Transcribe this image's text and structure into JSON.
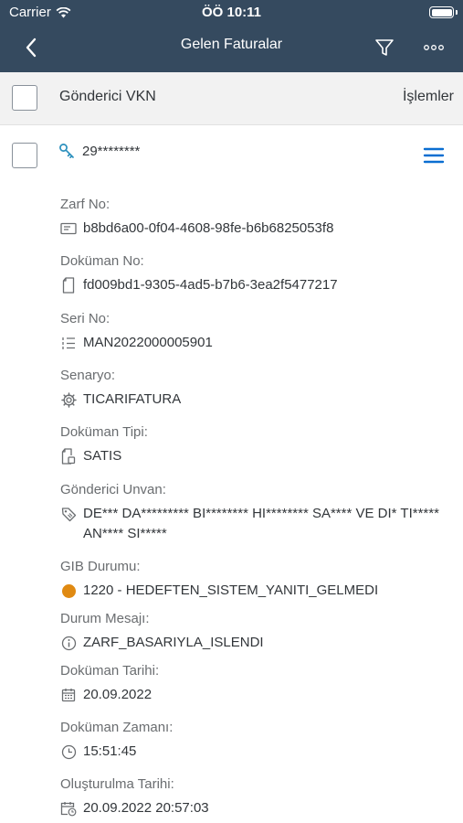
{
  "status_bar": {
    "carrier": "Carrier",
    "time": "ÖÖ 10:11"
  },
  "nav": {
    "title": "Gelen Faturalar"
  },
  "list_header": {
    "column_title": "Gönderici VKN",
    "actions_label": "İşlemler"
  },
  "item": {
    "vkn": "29********",
    "fields": [
      {
        "label": "Zarf No:",
        "value": "b8bd6a00-0f04-4608-98fe-b6b6825053f8",
        "icon": "envelope-icon"
      },
      {
        "label": "Doküman No:",
        "value": "fd009bd1-9305-4ad5-b7b6-3ea2f5477217",
        "icon": "document-icon"
      },
      {
        "label": "Seri No:",
        "value": "MAN2022000005901",
        "icon": "numbered-list-icon"
      },
      {
        "label": "Senaryo:",
        "value": "TICARIFATURA",
        "icon": "gear-icon"
      },
      {
        "label": "Doküman Tipi:",
        "value": "SATIS",
        "icon": "document-type-icon"
      },
      {
        "label": "Gönderici Unvan:",
        "value": "DE*** DA********* BI******** HI******** SA**** VE DI* TI***** AN**** SI*****",
        "icon": "tag-icon"
      },
      {
        "label": "GIB Durumu:",
        "value": "1220 - HEDEFTEN_SISTEM_YANITI_GELMEDI",
        "icon": "status-dot-icon"
      },
      {
        "label": "Durum Mesajı:",
        "value": "ZARF_BASARIYLA_ISLENDI",
        "icon": "info-icon"
      },
      {
        "label": "Doküman Tarihi:",
        "value": "20.09.2022",
        "icon": "calendar-icon"
      },
      {
        "label": "Doküman Zamanı:",
        "value": "15:51:45",
        "icon": "clock-icon"
      },
      {
        "label": "Oluşturulma Tarihi:",
        "value": "20.09.2022 20:57:03",
        "icon": "calendar-clock-icon"
      }
    ]
  },
  "colors": {
    "header_bg": "#354a5f",
    "accent": "#0a6ed1",
    "warning": "#e08a12",
    "vkn_icon": "#2a8fbd"
  }
}
